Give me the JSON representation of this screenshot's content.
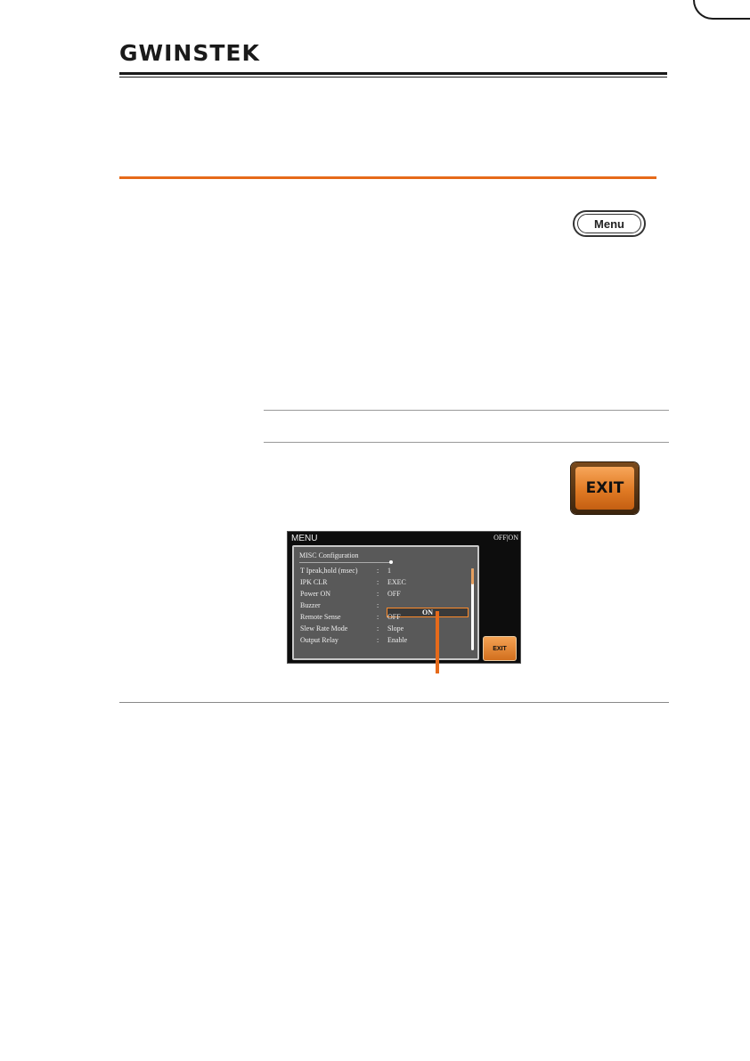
{
  "header": {
    "logo_text": "GWINSTEK"
  },
  "menu_key": {
    "label": "Menu"
  },
  "exit_key": {
    "label": "EXIT"
  },
  "screen": {
    "title": "MENU",
    "status": "OFF|ON",
    "panel_title": "MISC Configuration",
    "rows": [
      {
        "key": "T Ipeak,hold (msec)",
        "value": "1"
      },
      {
        "key": "IPK CLR",
        "value": "EXEC"
      },
      {
        "key": "Power ON",
        "value": "OFF"
      },
      {
        "key": "Buzzer",
        "value": "ON"
      },
      {
        "key": "Remote Sense",
        "value": "OFF"
      },
      {
        "key": "Slew Rate Mode",
        "value": "Slope"
      },
      {
        "key": "Output Relay",
        "value": "Enable"
      }
    ],
    "separator": ":",
    "exit_softkey": "EXIT"
  },
  "colors": {
    "accent": "#e66a1a",
    "screen_bg": "#0d0d0d",
    "panel_bg": "#595959",
    "highlight": "#ff8b2a"
  },
  "icons": {
    "menu_key": "menu-key-icon",
    "exit_key": "exit-key-icon",
    "pointer": "callout-pointer-icon"
  }
}
